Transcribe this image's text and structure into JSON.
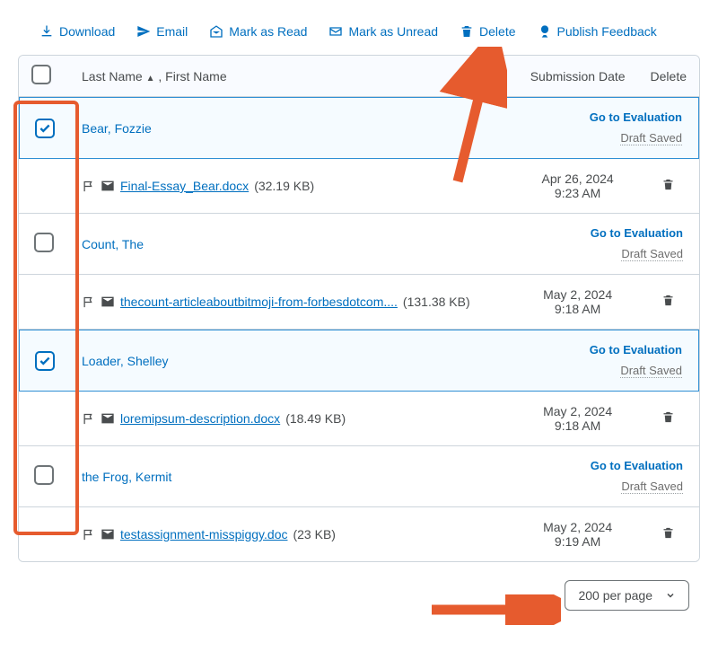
{
  "toolbar": {
    "download": "Download",
    "email": "Email",
    "mark_read": "Mark as Read",
    "mark_unread": "Mark as Unread",
    "delete": "Delete",
    "publish": "Publish Feedback"
  },
  "headers": {
    "name": "Last Name",
    "name_suffix": ", First Name",
    "submission_date": "Submission Date",
    "delete": "Delete"
  },
  "labels": {
    "go_to_eval": "Go to Evaluation",
    "draft_saved": "Draft Saved"
  },
  "students": [
    {
      "checked": true,
      "name": "Bear, Fozzie",
      "file": "Final-Essay_Bear.docx",
      "file_size": "(32.19 KB)",
      "date_line1": "Apr 26, 2024",
      "date_line2": "9:23 AM"
    },
    {
      "checked": false,
      "name": "Count, The",
      "file": "thecount-articleaboutbitmoji-from-forbesdotcom....",
      "file_size": "(131.38 KB)",
      "date_line1": "May 2, 2024",
      "date_line2": "9:18 AM"
    },
    {
      "checked": true,
      "name": "Loader, Shelley",
      "file": "loremipsum-description.docx",
      "file_size": "(18.49 KB)",
      "date_line1": "May 2, 2024",
      "date_line2": "9:18 AM"
    },
    {
      "checked": false,
      "name": "the Frog, Kermit",
      "file": "testassignment-misspiggy.doc",
      "file_size": "(23 KB)",
      "date_line1": "May 2, 2024",
      "date_line2": "9:19 AM"
    }
  ],
  "pager": {
    "label": "200 per page"
  }
}
